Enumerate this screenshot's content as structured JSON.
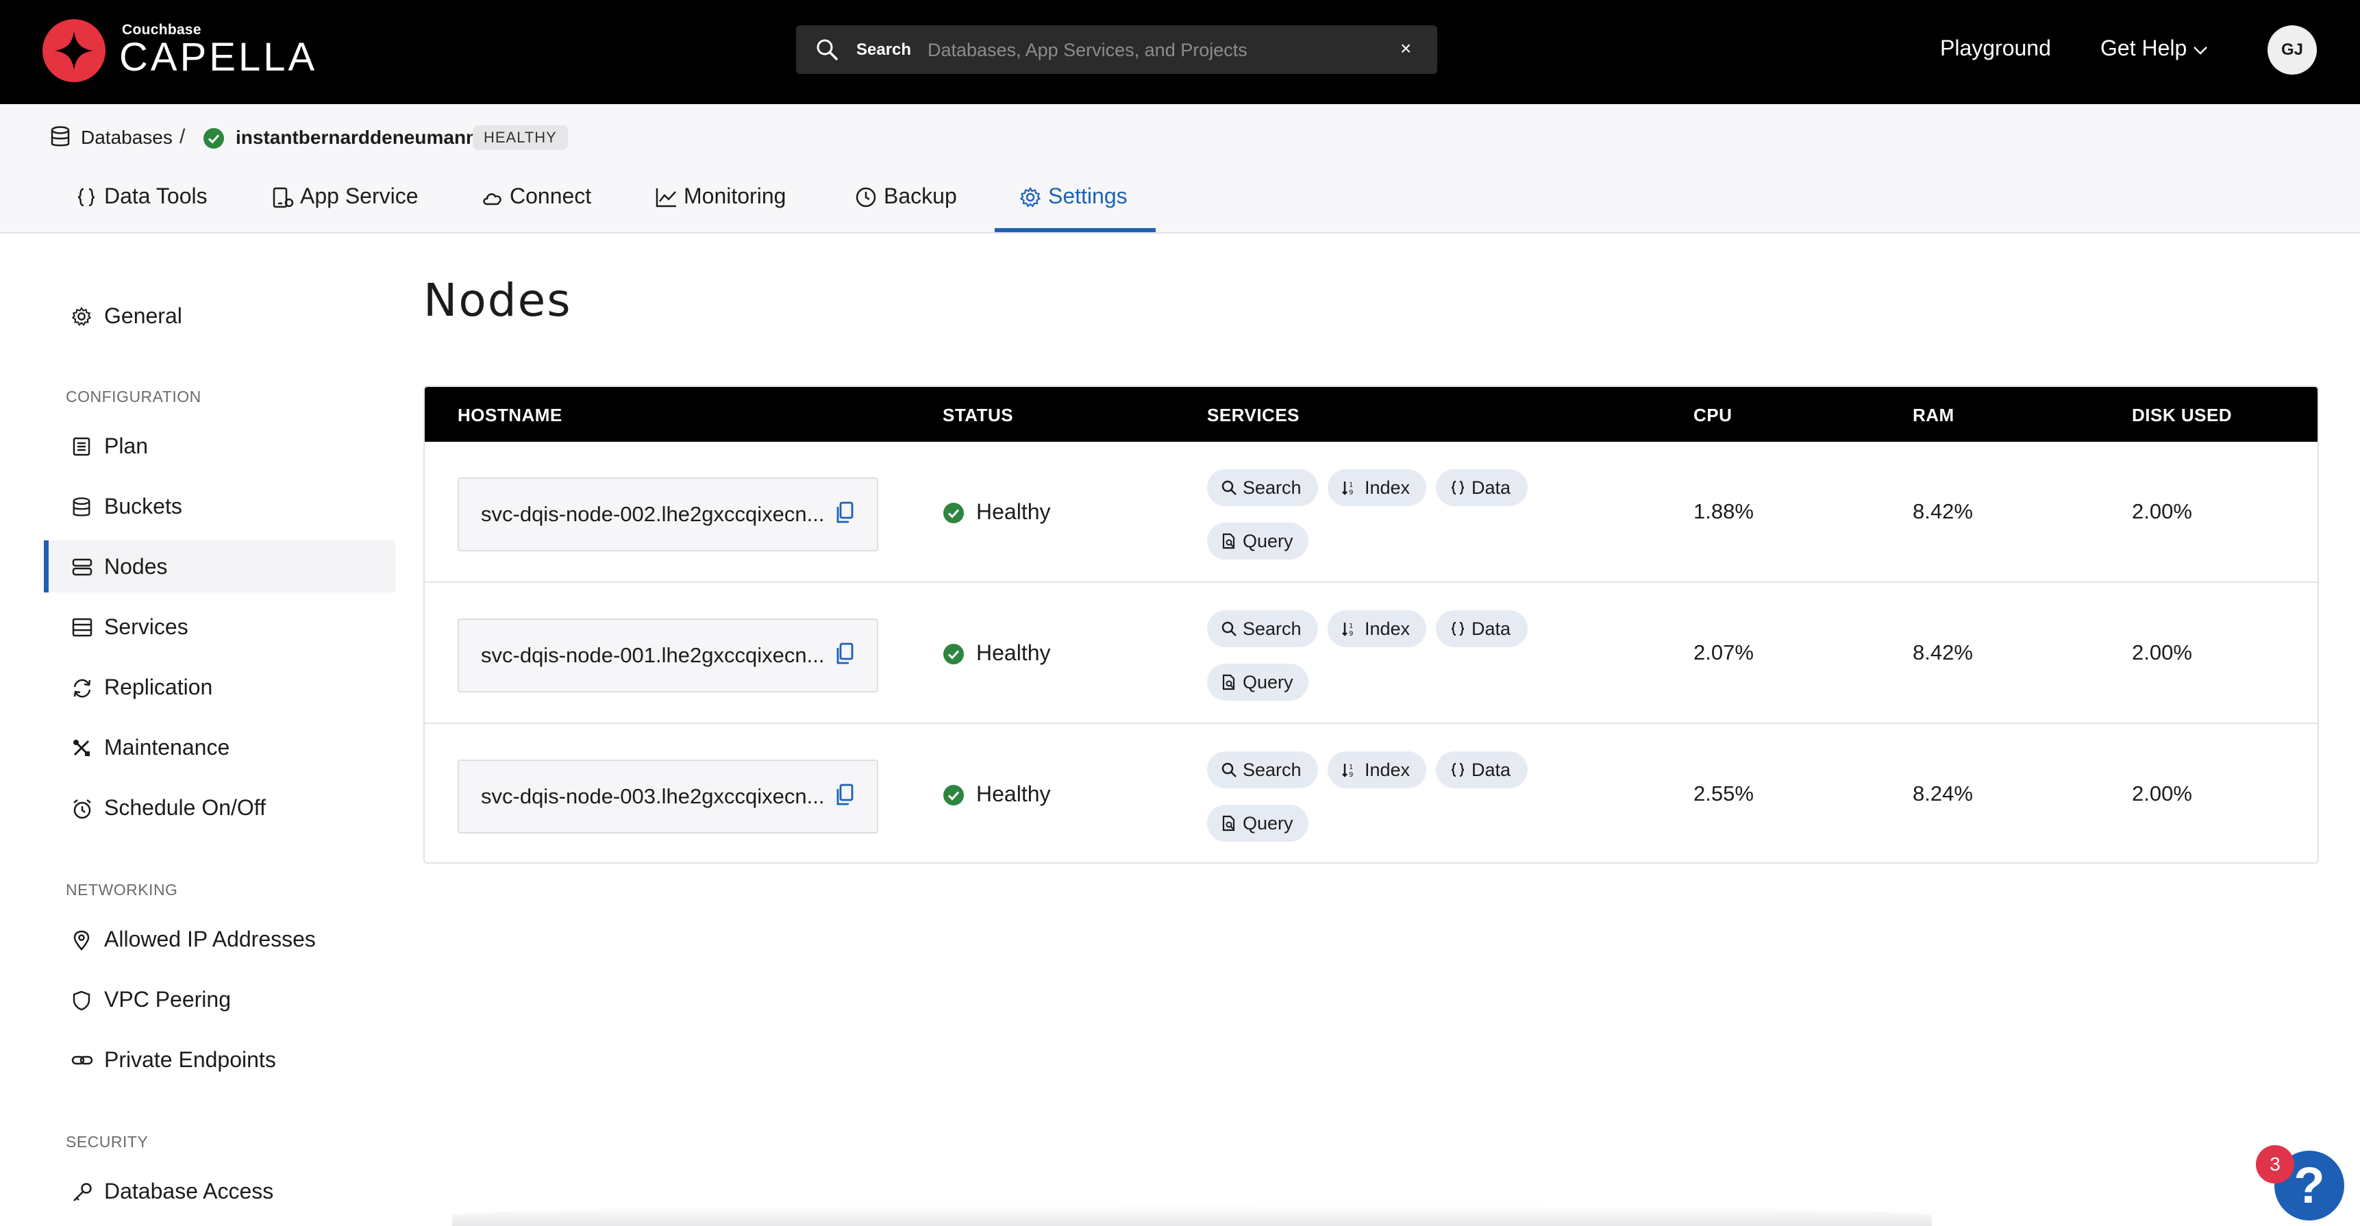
{
  "header": {
    "logo_small": "Couchbase",
    "logo_big": "CAPELLA",
    "search_label": "Search",
    "search_placeholder": "Databases, App Services, and Projects",
    "search_clear": "×",
    "nav_playground": "Playground",
    "nav_help": "Get Help",
    "avatar_initials": "GJ"
  },
  "breadcrumb": {
    "databases": "Databases",
    "separator": "/",
    "cluster": "instantbernarddeneumann",
    "status_badge": "HEALTHY"
  },
  "tabs": [
    {
      "label": "Data Tools"
    },
    {
      "label": "App Service"
    },
    {
      "label": "Connect"
    },
    {
      "label": "Monitoring"
    },
    {
      "label": "Backup"
    },
    {
      "label": "Settings",
      "active": true
    }
  ],
  "sidebar": {
    "general": "General",
    "sections": {
      "configuration": "CONFIGURATION",
      "networking": "NETWORKING",
      "security": "SECURITY"
    },
    "items": {
      "plan": "Plan",
      "buckets": "Buckets",
      "nodes": "Nodes",
      "services": "Services",
      "replication": "Replication",
      "maintenance": "Maintenance",
      "schedule": "Schedule On/Off",
      "allowed_ip": "Allowed IP Addresses",
      "vpc": "VPC Peering",
      "private_endpoints": "Private Endpoints",
      "database_access": "Database Access"
    }
  },
  "main": {
    "title": "Nodes",
    "columns": {
      "hostname": "HOSTNAME",
      "status": "STATUS",
      "services": "SERVICES",
      "cpu": "CPU",
      "ram": "RAM",
      "disk": "DISK USED"
    },
    "service_labels": {
      "search": "Search",
      "index": "Index",
      "data": "Data",
      "query": "Query"
    },
    "rows": [
      {
        "hostname": "svc-dqis-node-002.lhe2gxccqixecn...",
        "status": "Healthy",
        "cpu": "1.88%",
        "ram": "8.42%",
        "disk": "2.00%"
      },
      {
        "hostname": "svc-dqis-node-001.lhe2gxccqixecn...",
        "status": "Healthy",
        "cpu": "2.07%",
        "ram": "8.42%",
        "disk": "2.00%"
      },
      {
        "hostname": "svc-dqis-node-003.lhe2gxccqixecn...",
        "status": "Healthy",
        "cpu": "2.55%",
        "ram": "8.24%",
        "disk": "2.00%"
      }
    ]
  },
  "help": {
    "badge_count": "3",
    "fab_label": "?"
  },
  "colors": {
    "accent": "#1d62b5",
    "brand_red": "#e5333f",
    "healthy_green": "#2e8540",
    "header_bg": "#000000",
    "chip_bg": "#e6ebf3"
  }
}
